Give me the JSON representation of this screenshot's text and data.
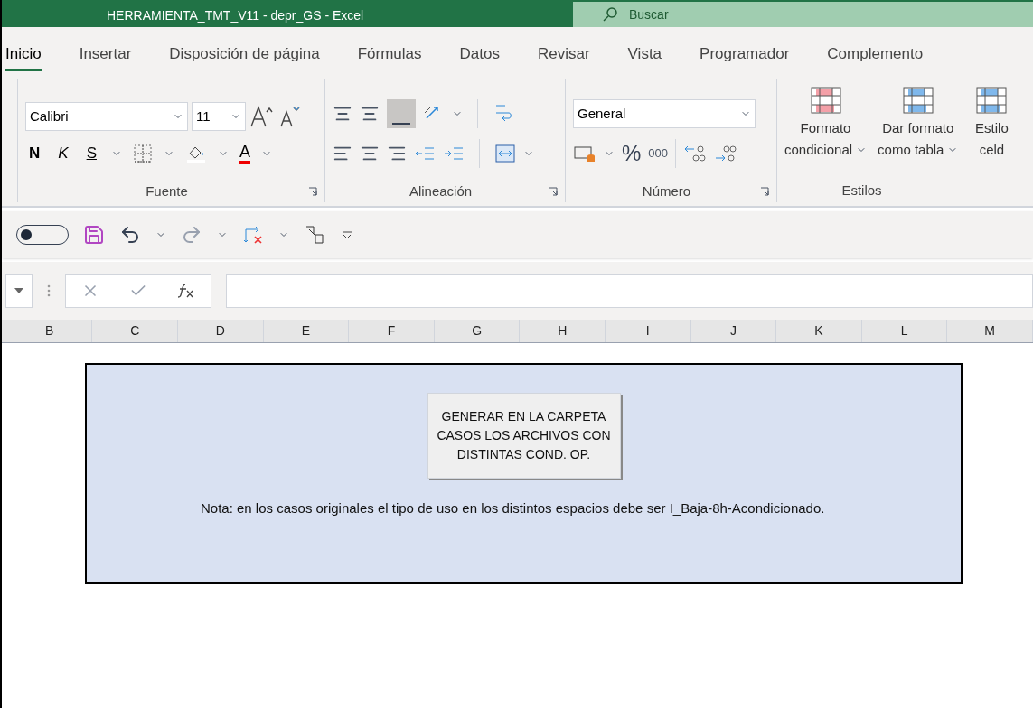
{
  "window": {
    "title": "HERRAMIENTA_TMT_V11 - depr_GS  -  Excel"
  },
  "search": {
    "placeholder": "Buscar"
  },
  "autosave": {
    "on": false
  },
  "tabs": [
    {
      "label": "Inicio",
      "selected": true
    },
    {
      "label": "Insertar",
      "selected": false
    },
    {
      "label": "Disposición de página",
      "selected": false
    },
    {
      "label": "Fórmulas",
      "selected": false
    },
    {
      "label": "Datos",
      "selected": false
    },
    {
      "label": "Revisar",
      "selected": false
    },
    {
      "label": "Vista",
      "selected": false
    },
    {
      "label": "Programador",
      "selected": false
    },
    {
      "label": "Complemento",
      "selected": false
    }
  ],
  "ribbon": {
    "font": {
      "label": "Fuente",
      "name": "Calibri",
      "size": "11",
      "bold": "N",
      "italic": "K",
      "underline": "S",
      "color_letter": "A"
    },
    "alignment": {
      "label": "Alineación"
    },
    "number": {
      "label": "Número",
      "format": "General",
      "percent": "%",
      "thousands": "000"
    },
    "styles": {
      "label": "Estilos",
      "buttons": [
        {
          "line1": "Formato",
          "line2": "condicional"
        },
        {
          "line1": "Dar formato",
          "line2": "como tabla"
        },
        {
          "line1": "Estilo",
          "line2": "celd"
        }
      ]
    }
  },
  "columns": [
    "B",
    "C",
    "D",
    "E",
    "F",
    "G",
    "H",
    "I",
    "J",
    "K",
    "L",
    "M"
  ],
  "sheet_box": {
    "button": "GENERAR EN LA CARPETA CASOS LOS ARCHIVOS CON DISTINTAS COND. OP.",
    "note": "Nota: en los casos originales el tipo de uso en los distintos espacios debe ser I_Baja-8h-Acondicionado."
  }
}
